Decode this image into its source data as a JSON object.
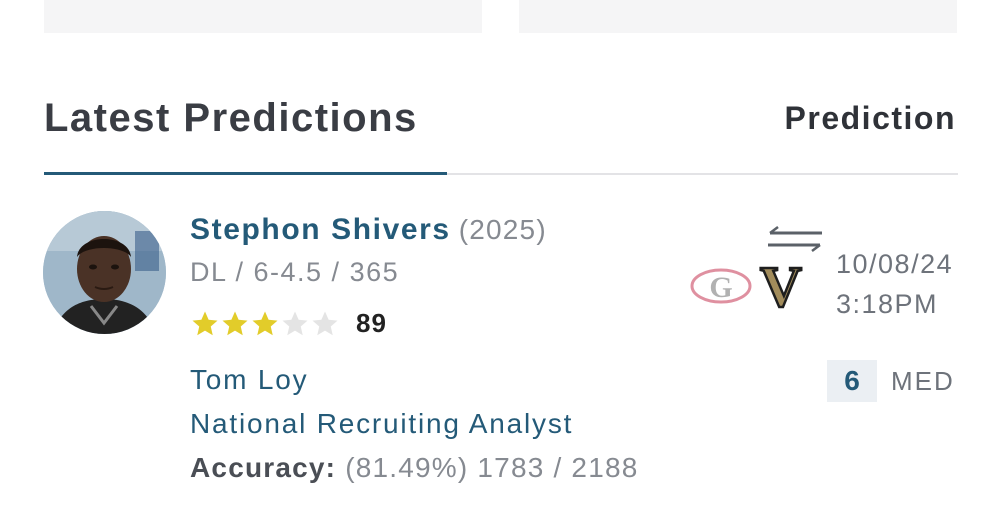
{
  "section": {
    "title": "Latest Predictions",
    "column_header": "Prediction"
  },
  "player": {
    "name": "Stephon Shivers",
    "year": "(2025)",
    "meta": "DL / 6-4.5 / 365",
    "stars": 3,
    "max_stars": 5,
    "rating": "89"
  },
  "analyst": {
    "name": "Tom Loy",
    "title": "National Recruiting Analyst",
    "accuracy_label": "Accuracy:",
    "accuracy_value": "(81.49%) 1783 / 2188"
  },
  "prediction": {
    "transfer_icon": "flip-arrows-icon",
    "from_team_logo": "G",
    "to_team_logo": "V",
    "date": "10/08/24",
    "time": "3:18PM",
    "confidence_score": "6",
    "confidence_level": "MED"
  },
  "colors": {
    "accent": "#245a78",
    "star_filled": "#e2cc2a",
    "star_empty": "#e4e4e4",
    "vanderbilt_gold": "#a28c5b",
    "georgia_red": "#ba0c2f"
  }
}
